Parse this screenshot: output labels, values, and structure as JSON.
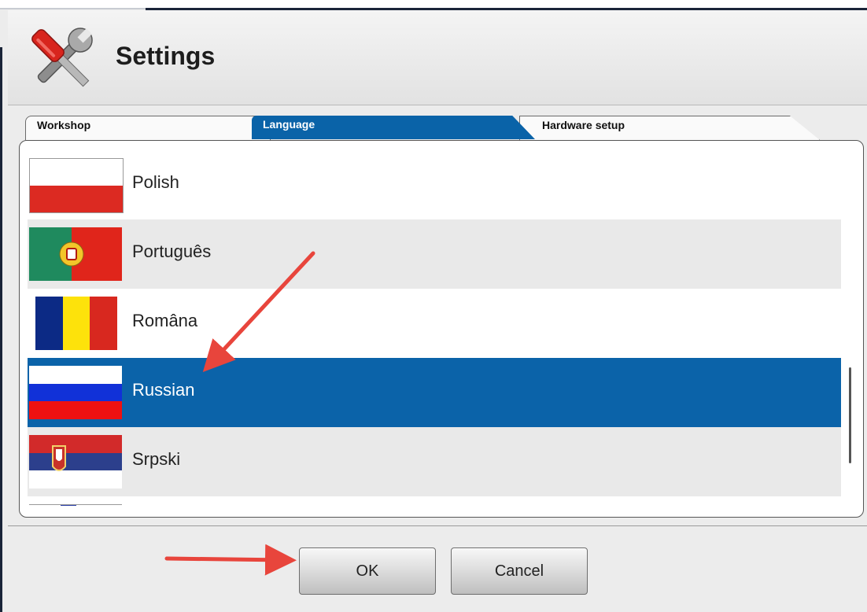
{
  "window": {
    "title": "Settings",
    "icon": "screwdriver-wrench-icon"
  },
  "tabs": [
    {
      "label": "Workshop",
      "active": false
    },
    {
      "label": "Language",
      "active": true
    },
    {
      "label": "Hardware setup",
      "active": false
    }
  ],
  "languages": [
    {
      "label": "Polish",
      "flag": "poland-flag",
      "selected": false
    },
    {
      "label": "Português",
      "flag": "portugal-flag",
      "selected": false
    },
    {
      "label": "Româna",
      "flag": "romania-flag",
      "selected": false
    },
    {
      "label": "Russian",
      "flag": "russia-flag",
      "selected": true
    },
    {
      "label": "Srpski",
      "flag": "serbia-flag",
      "selected": false
    }
  ],
  "buttons": {
    "ok": "OK",
    "cancel": "Cancel"
  },
  "colors": {
    "accent": "#0b63a9",
    "annotation_arrow": "#e8453c"
  }
}
